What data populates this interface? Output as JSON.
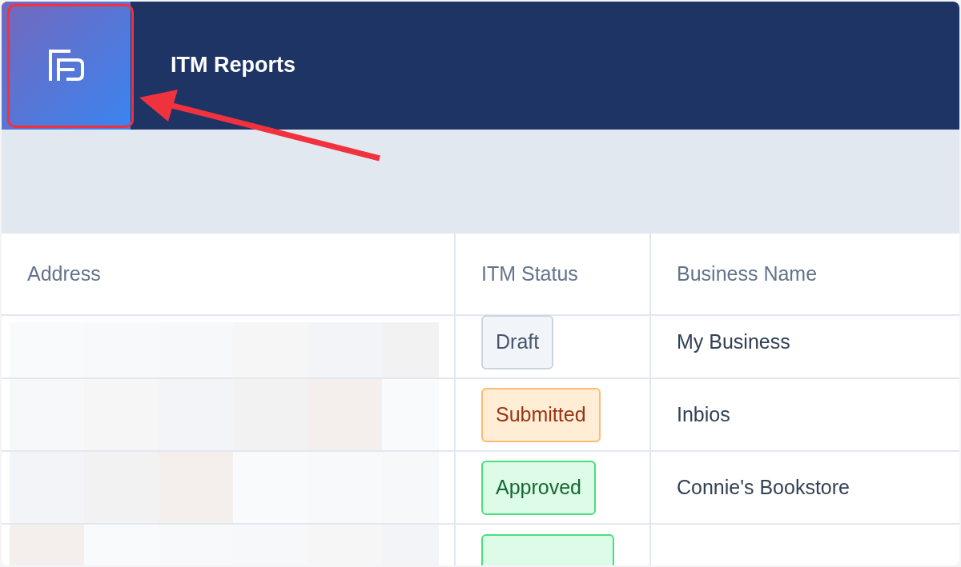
{
  "header": {
    "title": "ITM Reports"
  },
  "table": {
    "columns": [
      "Address",
      "ITM Status",
      "Business Name"
    ],
    "rows": [
      {
        "status": {
          "kind": "draft",
          "label": "Draft"
        },
        "business_name": "My Business"
      },
      {
        "status": {
          "kind": "submitted",
          "label": "Submitted"
        },
        "business_name": "Inbios"
      },
      {
        "status": {
          "kind": "approved",
          "label": "Approved"
        },
        "business_name": "Connie's Bookstore"
      },
      {
        "status": {
          "kind": "approved"
        }
      }
    ]
  }
}
